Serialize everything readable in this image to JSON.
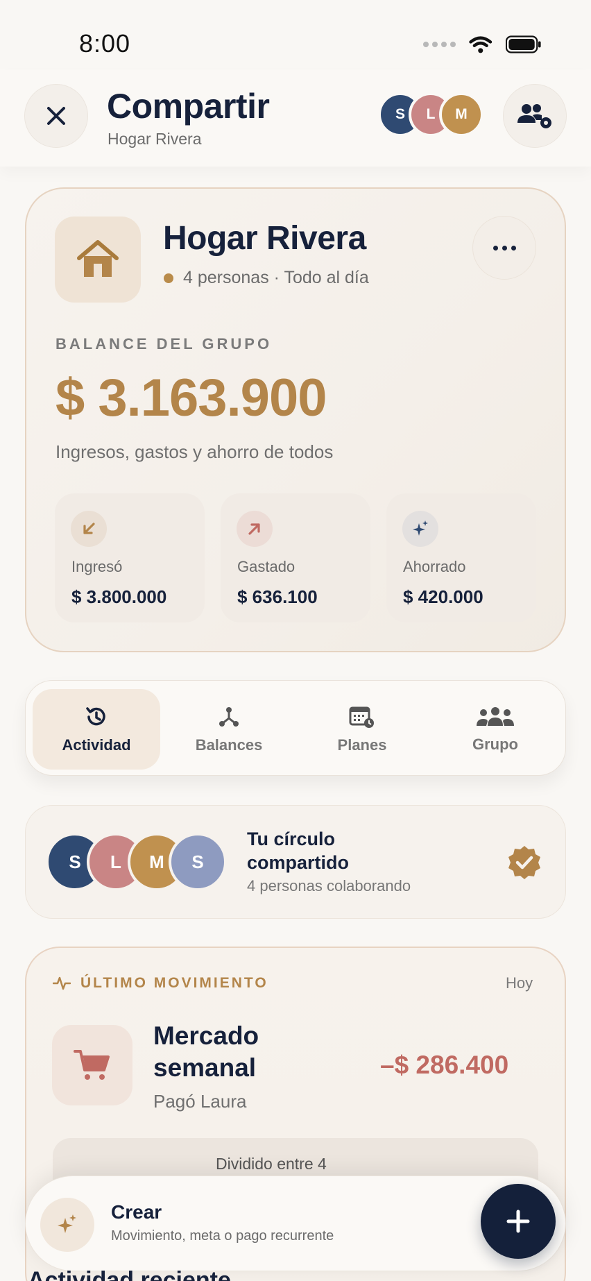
{
  "status": {
    "time": "8:00"
  },
  "header": {
    "title": "Compartir",
    "subtitle": "Hogar Rivera",
    "close_icon": "close-icon",
    "group_settings_icon": "group-settings-icon",
    "avatars": [
      {
        "initial": "S",
        "color": "#2f4a72"
      },
      {
        "initial": "L",
        "color": "#c98585"
      },
      {
        "initial": "M",
        "color": "#c0914f"
      }
    ]
  },
  "summary": {
    "group_name": "Hogar Rivera",
    "meta": "4 personas · Todo al día",
    "balance_label": "BALANCE DEL GRUPO",
    "balance_value": "$ 3.163.900",
    "balance_desc": "Ingresos, gastos y ahorro de todos",
    "stats": [
      {
        "label": "Ingresó",
        "value": "$ 3.800.000",
        "icon": "arrow-down-left-icon",
        "color": "#b3854a"
      },
      {
        "label": "Gastado",
        "value": "$ 636.100",
        "icon": "arrow-up-right-icon",
        "color": "#c06a62"
      },
      {
        "label": "Ahorrado",
        "value": "$ 420.000",
        "icon": "sparkles-icon",
        "color": "#2f4a72"
      }
    ]
  },
  "tabs": [
    {
      "label": "Actividad",
      "icon": "history-icon",
      "active": true
    },
    {
      "label": "Balances",
      "icon": "split-icon",
      "active": false
    },
    {
      "label": "Planes",
      "icon": "calendar-icon",
      "active": false
    },
    {
      "label": "Grupo",
      "icon": "people-icon",
      "active": false
    }
  ],
  "circle": {
    "title": "Tu círculo compartido",
    "subtitle": "4 personas colaborando",
    "avatars": [
      {
        "initial": "S",
        "color": "#2f4a72"
      },
      {
        "initial": "L",
        "color": "#c98585"
      },
      {
        "initial": "M",
        "color": "#c0914f"
      },
      {
        "initial": "S",
        "color": "#8e9bc0"
      }
    ]
  },
  "last_movement": {
    "label": "ÚLTIMO MOVIMIENTO",
    "date": "Hoy",
    "title": "Mercado semanal",
    "payer": "Pagó Laura",
    "amount": "–$ 286.400",
    "split_text": "Dividido entre 4"
  },
  "create": {
    "title": "Crear",
    "subtitle": "Movimiento, meta o pago recurrente"
  },
  "peek": {
    "section_title": "Actividad reciente"
  }
}
